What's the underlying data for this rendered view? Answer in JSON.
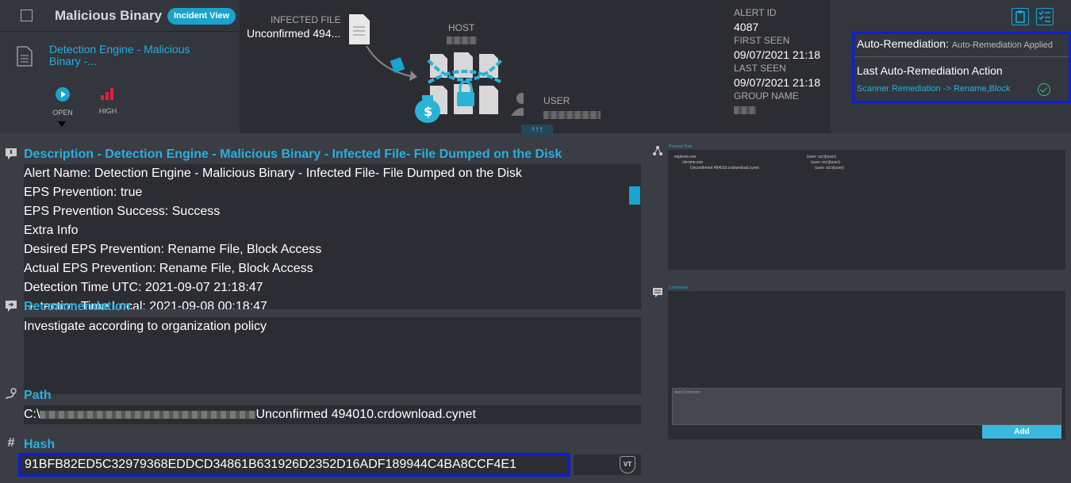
{
  "header": {
    "title": "Malicious Binary",
    "incident_view_label": "Incident View",
    "engine_title": "Detection Engine - Malicious Binary -...",
    "status": {
      "open_label": "OPEN",
      "severity_label": "HIGH"
    },
    "infected_file": {
      "label": "INFECTED FILE",
      "value": "Unconfirmed 494..."
    },
    "host_label": "HOST",
    "user_label": "USER",
    "expand_label": "↑↑↑",
    "alert": {
      "id_label": "ALERT ID",
      "id_value": "4087",
      "first_seen_label": "FIRST SEEN",
      "first_seen_value": "09/07/2021 21:18",
      "last_seen_label": "LAST SEEN",
      "last_seen_value": "09/07/2021 21:18",
      "group_label": "GROUP NAME"
    },
    "remediation": {
      "label": "Auto-Remediation:",
      "status": "Auto-Remediation Applied",
      "last_action_label": "Last Auto-Remediation Action",
      "last_action_value": "Scanner Remediation -> Rename,Block"
    }
  },
  "description": {
    "title": "Description - Detection Engine - Malicious Binary - Infected File- File Dumped on the Disk",
    "lines": [
      "Alert Name: Detection Engine - Malicious Binary - Infected File- File Dumped on the Disk",
      "EPS Prevention: true",
      "EPS Prevention Success: Success",
      "Extra Info",
      "Desired EPS Prevention: Rename File, Block Access",
      "Actual EPS Prevention: Rename File, Block Access",
      "Detection Time UTC: 2021-09-07 21:18:47",
      "Detection Time Local: 2021-09-08 00:18:47"
    ]
  },
  "recommendation": {
    "title": "Recommendation",
    "text": "Investigate according to organization policy"
  },
  "path": {
    "title": "Path",
    "prefix": "C:\\",
    "filename": "Unconfirmed 494010.crdownload.cynet"
  },
  "hash": {
    "title": "Hash",
    "value": "91BFB82ED5C32979368EDDCD34861B631926D2352D16ADF189944C4BA8CCF4E1",
    "vt_label": "VT"
  },
  "process_tree": {
    "title": "Process Tree",
    "rows": [
      {
        "name": "explorer.exe",
        "user": "(user: scc\\j\\user)"
      },
      {
        "name": "chrome.exe",
        "user": "(user: scc\\j\\user)"
      },
      {
        "name": "Unconfirmed 494010.crdownload.cynet",
        "user": "(user: scc\\j\\user)"
      }
    ]
  },
  "comments": {
    "title": "Comments",
    "placeholder": "Add Comment",
    "add_label": "Add"
  }
}
